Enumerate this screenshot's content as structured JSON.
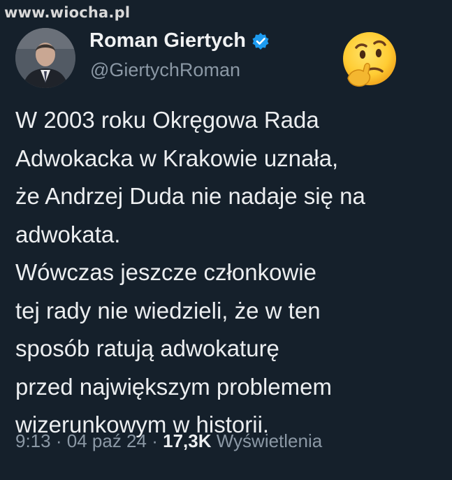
{
  "watermark": "www.wiocha.pl",
  "author": {
    "name": "Roman Giertych",
    "handle": "@GiertychRoman",
    "verified": true
  },
  "reaction_emoji": "thinking-face",
  "tweet": {
    "lines": [
      "W 2003 roku Okręgowa Rada",
      "Adwokacka w Krakowie uznała,",
      "że Andrzej Duda nie nadaje się na",
      "adwokata.",
      "Wówczas jeszcze członkowie",
      "tej rady nie wiedzieli, że w ten",
      "sposób ratują adwokaturę",
      "przed największym problemem",
      "wizerunkowym w historii."
    ]
  },
  "meta": {
    "time": "9:13",
    "separator": "·",
    "date": "04 paź 24",
    "views_count": "17,3K",
    "views_label": "Wyświetlenia"
  },
  "colors": {
    "background": "#15202b",
    "text": "#e7e9ea",
    "secondary": "#8b98a5",
    "verified": "#1d9bf0"
  }
}
